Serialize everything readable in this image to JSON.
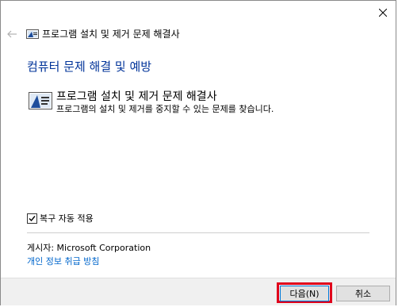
{
  "header": {
    "title": "프로그램 설치 및 제거 문제 해결사"
  },
  "main": {
    "section_heading": "컴퓨터 문제 해결 및 예방",
    "app_title": "프로그램 설치 및 제거 문제 해결사",
    "app_description": "프로그램의 설치 및 제거를 중지할 수 있는 문제를 찾습니다."
  },
  "options": {
    "auto_apply_label": "복구 자동 적용",
    "auto_apply_checked": true
  },
  "publisher": {
    "text": "게시자:  Microsoft Corporation"
  },
  "links": {
    "privacy": "개인 정보 취급 방침"
  },
  "footer": {
    "next_label": "다음(N)",
    "cancel_label": "취소"
  },
  "icons": {
    "close": "close-icon",
    "back": "back-arrow-icon",
    "troubleshooter": "troubleshooter-icon",
    "checkmark": "checkmark-icon"
  },
  "colors": {
    "heading": "#003399",
    "link": "#0066cc",
    "highlight": "#e0001b",
    "footer_bg": "#f0f0f0"
  }
}
